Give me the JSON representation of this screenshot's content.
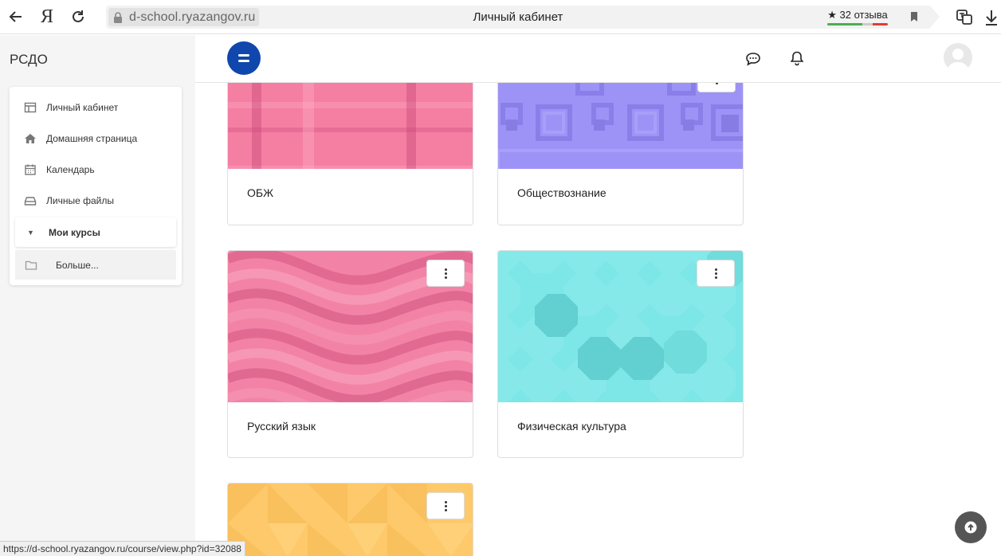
{
  "browser": {
    "domain": "d-school.ryazangov.ru",
    "tab_title": "Личный кабинет",
    "reviews_label": "★ 32 отзыва",
    "brand_glyph": "Я",
    "icons": [
      "back-arrow-icon",
      "yandex-logo",
      "reload-icon",
      "lock-icon",
      "bookmark-icon",
      "translate-icon",
      "download-icon"
    ]
  },
  "sidebar": {
    "site_name": "РСДО",
    "items": [
      {
        "label": "Личный кабинет",
        "icon": "dashboard-icon"
      },
      {
        "label": "Домашняя страница",
        "icon": "home-icon"
      },
      {
        "label": "Календарь",
        "icon": "calendar-icon"
      },
      {
        "label": "Личные файлы",
        "icon": "files-icon"
      },
      {
        "label": "Мои курсы",
        "icon": "caret-down-icon"
      },
      {
        "label": "Больше...",
        "icon": "folder-icon"
      }
    ]
  },
  "topnav": {
    "icons": [
      "drawer-toggle-icon",
      "messages-icon",
      "notifications-icon",
      "user-avatar"
    ]
  },
  "courses": [
    {
      "name": "ОБЖ",
      "color": "#f57ea3"
    },
    {
      "name": "Обществознание",
      "color": "#9d93f6"
    },
    {
      "name": "Русский язык",
      "color": "#f283a7"
    },
    {
      "name": "Физическая культура",
      "color": "#7de6e6"
    },
    {
      "name": "",
      "color": "#fdc96a"
    }
  ],
  "status_bar": {
    "url": "https://d-school.ryazangov.ru/course/view.php?id=32088"
  },
  "colors": {
    "accent": "#0f47ad",
    "sidebar_bg": "#f5f5f5"
  }
}
